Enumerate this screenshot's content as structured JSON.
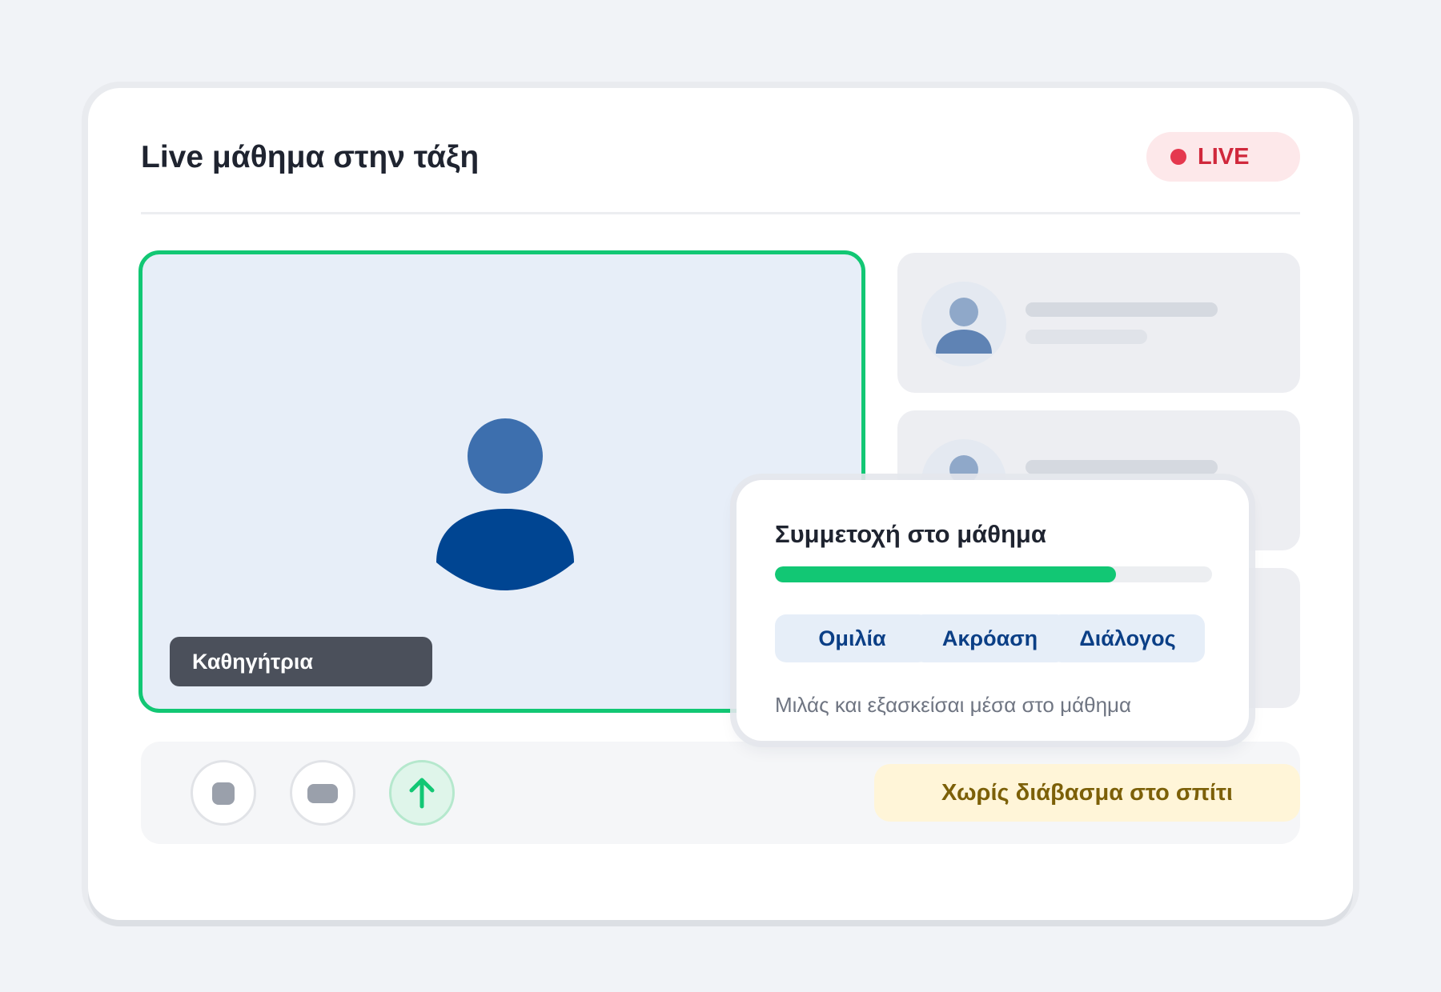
{
  "header": {
    "title": "Live μάθημα στην τάξη",
    "live_label": "LIVE"
  },
  "main_video": {
    "speaker_label": "Καθηγήτρια"
  },
  "controls": {
    "homework_label": "Χωρίς διάβασμα στο σπίτι"
  },
  "participation": {
    "title": "Συμμετοχή στο μάθημα",
    "progress_percent": 78,
    "chips": [
      "Ομιλία",
      "Ακρόαση",
      "Διάλογος"
    ],
    "description": "Μιλάς και εξασκείσαι μέσα στο μάθημα"
  },
  "colors": {
    "accent_green": "#12c774",
    "live_red": "#e5384e",
    "avatar_blue": "#3d6fae",
    "avatar_dark_blue": "#004592",
    "chip_text": "#0b3f86",
    "homework_text": "#7c6008"
  },
  "icons": {
    "mic": "mic-icon",
    "camera": "camera-icon",
    "raise_hand": "arrow-up-icon",
    "avatar": "user-avatar-icon"
  }
}
